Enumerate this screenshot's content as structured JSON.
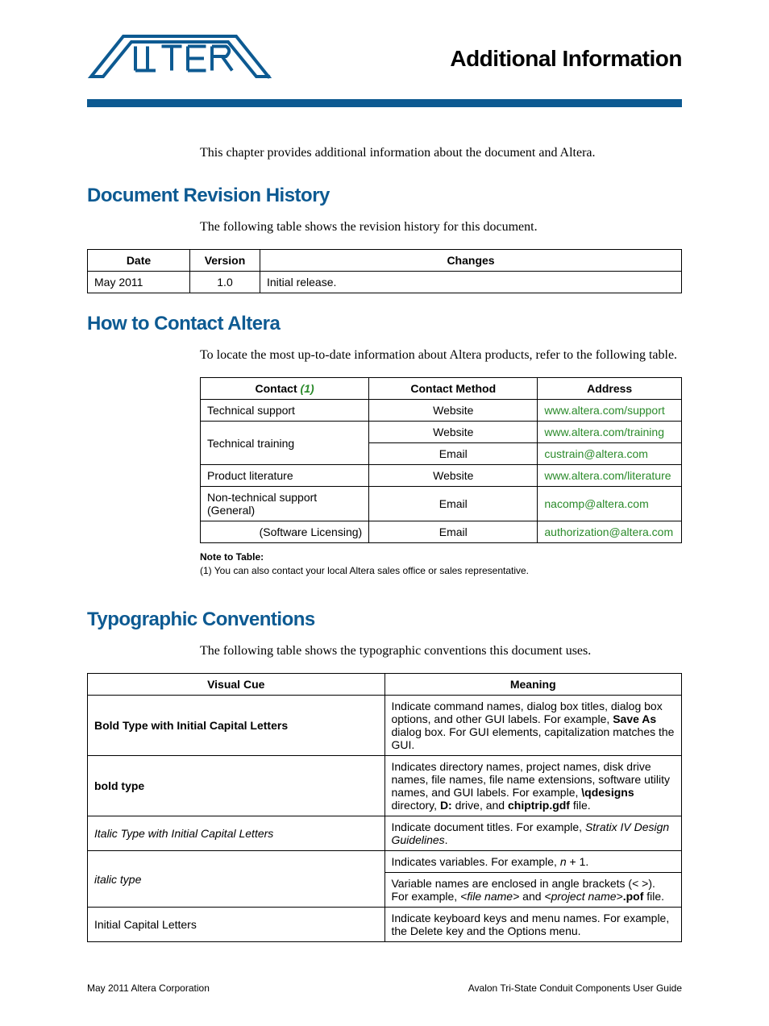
{
  "page_title": "Additional Information",
  "intro": "This chapter provides additional information about the document and Altera.",
  "sections": {
    "revision": {
      "heading": "Document Revision History",
      "intro": "The following table shows the revision history for this document.",
      "headers": {
        "date": "Date",
        "version": "Version",
        "changes": "Changes"
      },
      "rows": [
        {
          "date": "May 2011",
          "version": "1.0",
          "changes": "Initial release."
        }
      ]
    },
    "contact": {
      "heading": "How to Contact Altera",
      "intro": "To locate the most up-to-date information about Altera products, refer to the following table.",
      "headers": {
        "contact": "Contact",
        "ref": "(1)",
        "method": "Contact Method",
        "address": "Address"
      },
      "rows": [
        {
          "contact": "Technical support",
          "method": "Website",
          "address": "www.altera.com/support"
        },
        {
          "contact": "Technical training",
          "method": "Website",
          "address": "www.altera.com/training"
        },
        {
          "contact": "",
          "method": "Email",
          "address": "custrain@altera.com"
        },
        {
          "contact": "Product literature",
          "method": "Website",
          "address": "www.altera.com/literature"
        },
        {
          "contact": "Non-technical support (General)",
          "method": "Email",
          "address": "nacomp@altera.com"
        },
        {
          "contact": "(Software Licensing)",
          "method": "Email",
          "address": "authorization@altera.com"
        }
      ],
      "note_label": "Note to Table:",
      "note_text": "(1)   You can also contact your local Altera sales office or sales representative."
    },
    "typo": {
      "heading": "Typographic Conventions",
      "intro": "The following table shows the typographic conventions this document uses.",
      "headers": {
        "cue": "Visual Cue",
        "meaning": "Meaning"
      },
      "rows": {
        "r0": {
          "cue": "Bold Type with Initial Capital Letters",
          "m_a": "Indicate command names, dialog box titles, dialog box options, and other GUI labels. For example, ",
          "m_b": "Save As",
          "m_c": " dialog box. For GUI elements, capitalization matches the GUI."
        },
        "r1": {
          "cue": "bold type",
          "m_a": "Indicates directory names, project names, disk drive names, file names, file name extensions, software utility names, and GUI labels. For example, ",
          "m_b": "\\qdesigns",
          "m_c": " directory, ",
          "m_d": "D:",
          "m_e": " drive, and ",
          "m_f": "chiptrip.gdf",
          "m_g": " file."
        },
        "r2": {
          "cue": "Italic Type with Initial Capital Letters",
          "m_a": "Indicate document titles. For example, ",
          "m_b": "Stratix IV Design Guidelines",
          "m_c": "."
        },
        "r3": {
          "cue": "italic type",
          "m1_a": "Indicates variables. For example, ",
          "m1_b": "n",
          "m1_c": " + 1.",
          "m2_a": "Variable names are enclosed in angle brackets (< >). For example, ",
          "m2_b": "<file name>",
          "m2_c": " and ",
          "m2_d": "<project name>",
          "m2_e": ".pof",
          "m2_f": " file."
        },
        "r4": {
          "cue": "Initial Capital Letters",
          "m_a": "Indicate keyboard keys and menu names. For example, the Delete key and the Options menu."
        }
      }
    }
  },
  "footer": {
    "left": "May 2011   Altera Corporation",
    "right": "Avalon Tri-State Conduit Components User Guide"
  }
}
